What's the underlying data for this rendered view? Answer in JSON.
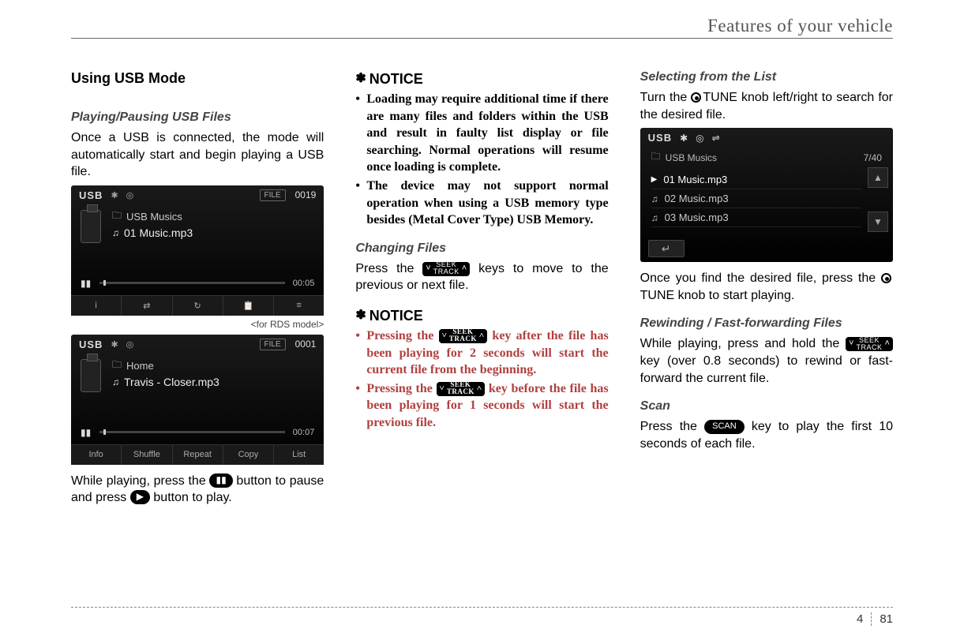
{
  "header": {
    "title": "Features of your vehicle"
  },
  "footer": {
    "section": "4",
    "page": "81"
  },
  "col1": {
    "h1": "Using USB Mode",
    "h2": "Playing/Pausing USB Files",
    "intro": "Once a USB is connected, the mode will automatically start and begin playing a USB file.",
    "caption": "<for RDS model>",
    "after_images_1": "While playing, press the ",
    "after_images_2": " button to pause and press ",
    "after_images_3": " button to play.",
    "pause_glyph": "▮▮",
    "play_glyph": "▶",
    "screen1": {
      "mode": "USB",
      "file_badge": "FILE",
      "file_no": "0019",
      "folder": "USB Musics",
      "track": "01 Music.mp3",
      "time": "00:05",
      "pp": "▮▮",
      "btns": [
        "i",
        "⇄",
        "↻",
        "📋",
        "≡"
      ]
    },
    "screen2": {
      "mode": "USB",
      "file_badge": "FILE",
      "file_no": "0001",
      "folder": "Home",
      "track": "Travis - Closer.mp3",
      "time": "00:07",
      "pp": "▮▮",
      "btns": [
        "Info",
        "Shuffle",
        "Repeat",
        "Copy",
        "List"
      ]
    }
  },
  "col2": {
    "notice_label": "NOTICE",
    "notice1_b1": "Loading may require additional time if there are many files and folders within the USB and result in faulty list display or file searching. Normal operations will resume once loading is complete.",
    "notice1_b2": "The device may not support normal operation when using a USB memory type besides (Metal Cover Type) USB Memory.",
    "h2_changing": "Changing Files",
    "changing_1": "Press the ",
    "changing_2": " keys to move to the previous or next file.",
    "seek_l1": "SEEK",
    "seek_l2": "TRACK",
    "notice2_b1a": "Pressing the ",
    "notice2_b1b": " key after the file has been playing for 2 seconds will start the current file from the beginning.",
    "notice2_b2a": "Pressing the ",
    "notice2_b2b": " key before the file has been playing for 1 seconds will start the previous file."
  },
  "col3": {
    "h2_sel": "Selecting from the List",
    "sel_1a": "Turn the ",
    "sel_1b": "TUNE knob left/right to search for the desired file.",
    "list_after_1": "Once you find the desired file, press the ",
    "list_after_2": "TUNE knob to start playing.",
    "h2_rw": "Rewinding / Fast-forwarding Files",
    "rw_1a": "While playing, press and hold the ",
    "rw_1b": " key (over 0.8 seconds) to rewind or fast-forward the current file.",
    "h2_scan": "Scan",
    "scan_1a": "Press the ",
    "scan_btn": "SCAN",
    "scan_1b": " key to play the first 10 seconds of each file.",
    "list_screen": {
      "mode": "USB",
      "folder": "USB Musics",
      "counter": "7/40",
      "rows": [
        "01 Music.mp3",
        "02 Music.mp3",
        "03 Music.mp3"
      ],
      "up": "▲",
      "down": "▼",
      "back": "↵"
    }
  }
}
